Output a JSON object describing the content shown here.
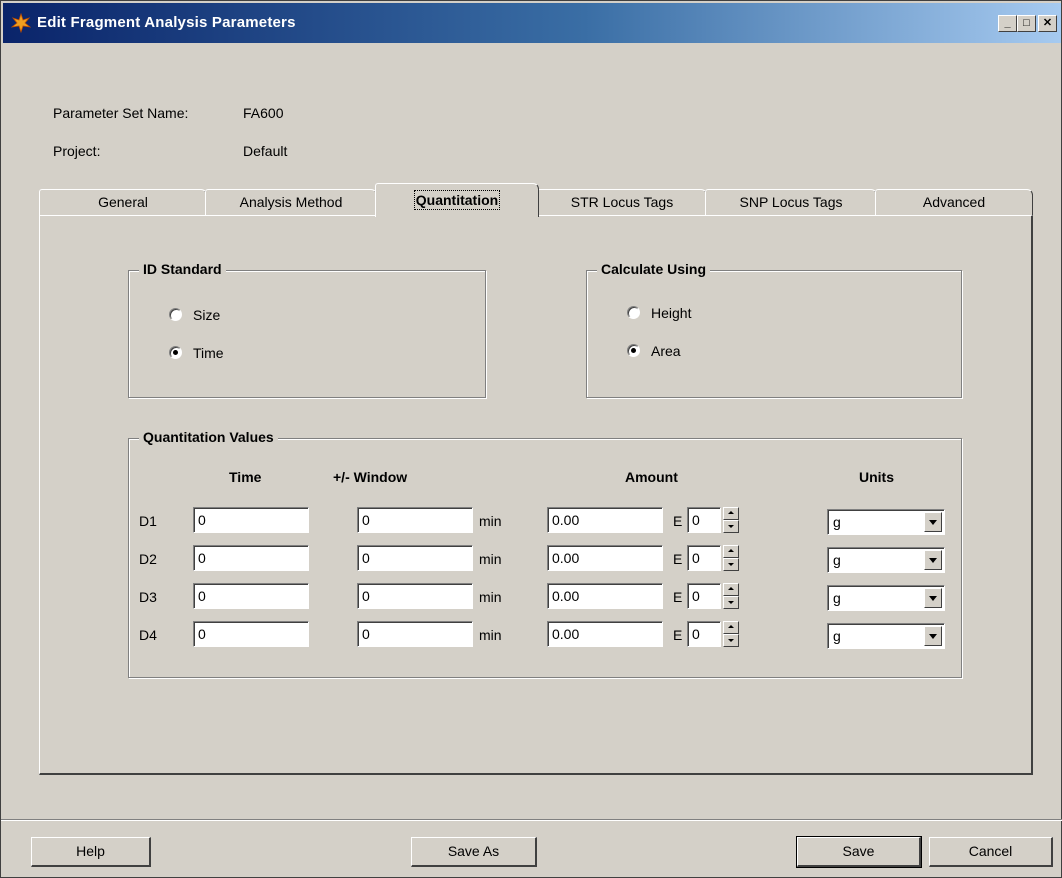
{
  "window": {
    "title": "Edit Fragment Analysis Parameters",
    "controls": {
      "minimize": "_",
      "maximize": "□",
      "close": "✕"
    }
  },
  "header": {
    "param_set_label": "Parameter Set Name:",
    "param_set_value": "FA600",
    "project_label": "Project:",
    "project_value": "Default"
  },
  "tabs": [
    {
      "label": "General",
      "active": false
    },
    {
      "label": "Analysis Method",
      "active": false
    },
    {
      "label": "Quantitation",
      "active": true
    },
    {
      "label": "STR Locus Tags",
      "active": false
    },
    {
      "label": "SNP Locus Tags",
      "active": false
    },
    {
      "label": "Advanced",
      "active": false
    }
  ],
  "id_standard": {
    "title": "ID Standard",
    "options": [
      {
        "label": "Size",
        "selected": false
      },
      {
        "label": "Time",
        "selected": true
      }
    ]
  },
  "calculate_using": {
    "title": "Calculate Using",
    "options": [
      {
        "label": "Height",
        "selected": false
      },
      {
        "label": "Area",
        "selected": true
      }
    ]
  },
  "quant_values": {
    "title": "Quantitation Values",
    "headers": {
      "time": "Time",
      "window": "+/- Window",
      "amount": "Amount",
      "units": "Units"
    },
    "rows": [
      {
        "label": "D1",
        "time": "0",
        "window": "0",
        "window_unit": "min",
        "amount": "0.00",
        "exp_label": "E",
        "exponent": "0",
        "units": "g"
      },
      {
        "label": "D2",
        "time": "0",
        "window": "0",
        "window_unit": "min",
        "amount": "0.00",
        "exp_label": "E",
        "exponent": "0",
        "units": "g"
      },
      {
        "label": "D3",
        "time": "0",
        "window": "0",
        "window_unit": "min",
        "amount": "0.00",
        "exp_label": "E",
        "exponent": "0",
        "units": "g"
      },
      {
        "label": "D4",
        "time": "0",
        "window": "0",
        "window_unit": "min",
        "amount": "0.00",
        "exp_label": "E",
        "exponent": "0",
        "units": "g"
      }
    ]
  },
  "buttons": {
    "help": "Help",
    "save_as": "Save As",
    "save": "Save",
    "cancel": "Cancel"
  }
}
